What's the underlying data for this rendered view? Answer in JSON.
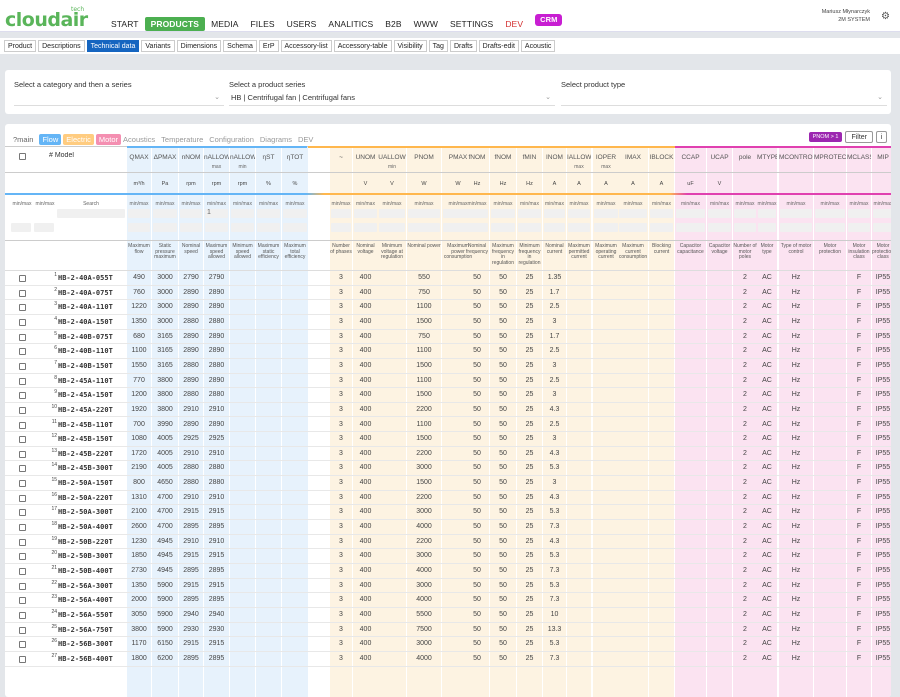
{
  "app": {
    "logo": "cloudair",
    "logo_sup": "tech",
    "nav": [
      "START",
      "PRODUCTS",
      "MEDIA",
      "FILES",
      "USERS",
      "ANALITICS",
      "B2B",
      "WWW",
      "SETTINGS",
      "DEV",
      "CRM"
    ],
    "active_nav": "PRODUCTS",
    "user_name": "Mariusz Młynarczyk",
    "user_company": "2M SYSTEM"
  },
  "subtabs": [
    "Product",
    "Descriptions",
    "Technical data",
    "Variants",
    "Dimensions",
    "Schema",
    "ErP",
    "Accessory-list",
    "Accessory-table",
    "Visibility",
    "Tag",
    "Drafts",
    "Drafts-edit",
    "Acoustic"
  ],
  "active_subtab": "Technical data",
  "filters": {
    "category_label": "Select a category and then a series",
    "category_value": "",
    "series_label": "Select a product series",
    "series_value": "HB | Centrifugal fan | Centrifugal fans",
    "type_label": "Select product type",
    "type_value": ""
  },
  "table_tabs": [
    "?main",
    "Flow",
    "Electric",
    "Motor",
    "Acoustics",
    "Temperature",
    "Configuration",
    "Diagrams",
    "DEV"
  ],
  "buttons": {
    "pnom": "PNOM > 1",
    "filter": "Filter",
    "info": "i"
  },
  "columns": {
    "model_header": "# Model",
    "search_label": "Search",
    "minmax": "min/max",
    "first_value": "1",
    "heads": [
      "QMAX",
      "ΔPMAX",
      "nNOM",
      "nALLOW",
      "nALLOW",
      "ηST",
      "ηTOT",
      "~",
      "UNOM",
      "UALLOW",
      "PNOM",
      "PMAX",
      "fNOM",
      "fNOM",
      "fMIN",
      "INOM",
      "IALLOW",
      "IOPER",
      "IMAX",
      "IBLOCK",
      "CCAP",
      "UCAP",
      "pole",
      "MTYPE",
      "MCONTROL",
      "MPROTECT",
      "MCLASS",
      "MIP"
    ],
    "subheads": [
      "",
      "",
      "",
      "max",
      "min",
      "",
      "",
      "",
      "",
      "min",
      "",
      "",
      "",
      "",
      "",
      "",
      "max",
      "max",
      "",
      "",
      "",
      "",
      "",
      "",
      "",
      "",
      "",
      ""
    ],
    "units": [
      "m³/h",
      "Pa",
      "rpm",
      "rpm",
      "rpm",
      "%",
      "%",
      "",
      "V",
      "V",
      "W",
      "W",
      "Hz",
      "Hz",
      "Hz",
      "A",
      "A",
      "A",
      "A",
      "A",
      "uF",
      "V",
      "",
      "",
      "",
      "",
      "",
      ""
    ],
    "descriptions": [
      "Maximum flow",
      "Static pressure maximum",
      "Nominal speed",
      "Maximum speed allowed",
      "Minimum speed allowed",
      "Maximum static efficiency",
      "Maximum total efficiency",
      "Number of phases",
      "Nominal voltage",
      "Minimum voltage at regulation",
      "Nominal power",
      "Maximum power consumption",
      "Nominal frequency",
      "Maximum frequency in regulation",
      "Minimum frequency in regulation",
      "Nominal current",
      "Maximum permitted current",
      "Maximum operating current",
      "Maximum current consumption",
      "Blocking current",
      "Capacitor capacitance",
      "Capacitor voltage",
      "Number of motor poles",
      "Motor type",
      "Type of motor control",
      "Motor protection",
      "Motor insulation class",
      "Motor protection class"
    ]
  },
  "rows": [
    {
      "n": "1",
      "model": "HB-2-40A-055T",
      "q": "490",
      "p": "3000",
      "n1": "2790",
      "n2": "2790",
      "ph": "3",
      "u": "400",
      "pw": "550",
      "f": "50",
      "f2": "50",
      "f3": "25",
      "i": "1.35",
      "pole": "2",
      "mt": "AC",
      "mc": "Hz",
      "cl": "F",
      "ip": "IP55"
    },
    {
      "n": "2",
      "model": "HB-2-40A-075T",
      "q": "760",
      "p": "3000",
      "n1": "2890",
      "n2": "2890",
      "ph": "3",
      "u": "400",
      "pw": "750",
      "f": "50",
      "f2": "50",
      "f3": "25",
      "i": "1.7",
      "pole": "2",
      "mt": "AC",
      "mc": "Hz",
      "cl": "F",
      "ip": "IP55"
    },
    {
      "n": "3",
      "model": "HB-2-40A-110T",
      "q": "1220",
      "p": "3000",
      "n1": "2890",
      "n2": "2890",
      "ph": "3",
      "u": "400",
      "pw": "1100",
      "f": "50",
      "f2": "50",
      "f3": "25",
      "i": "2.5",
      "pole": "2",
      "mt": "AC",
      "mc": "Hz",
      "cl": "F",
      "ip": "IP55"
    },
    {
      "n": "4",
      "model": "HB-2-40A-150T",
      "q": "1350",
      "p": "3000",
      "n1": "2880",
      "n2": "2880",
      "ph": "3",
      "u": "400",
      "pw": "1500",
      "f": "50",
      "f2": "50",
      "f3": "25",
      "i": "3",
      "pole": "2",
      "mt": "AC",
      "mc": "Hz",
      "cl": "F",
      "ip": "IP55"
    },
    {
      "n": "5",
      "model": "HB-2-40B-075T",
      "q": "680",
      "p": "3165",
      "n1": "2890",
      "n2": "2890",
      "ph": "3",
      "u": "400",
      "pw": "750",
      "f": "50",
      "f2": "50",
      "f3": "25",
      "i": "1.7",
      "pole": "2",
      "mt": "AC",
      "mc": "Hz",
      "cl": "F",
      "ip": "IP55"
    },
    {
      "n": "6",
      "model": "HB-2-40B-110T",
      "q": "1100",
      "p": "3165",
      "n1": "2890",
      "n2": "2890",
      "ph": "3",
      "u": "400",
      "pw": "1100",
      "f": "50",
      "f2": "50",
      "f3": "25",
      "i": "2.5",
      "pole": "2",
      "mt": "AC",
      "mc": "Hz",
      "cl": "F",
      "ip": "IP55"
    },
    {
      "n": "7",
      "model": "HB-2-40B-150T",
      "q": "1550",
      "p": "3165",
      "n1": "2880",
      "n2": "2880",
      "ph": "3",
      "u": "400",
      "pw": "1500",
      "f": "50",
      "f2": "50",
      "f3": "25",
      "i": "3",
      "pole": "2",
      "mt": "AC",
      "mc": "Hz",
      "cl": "F",
      "ip": "IP55"
    },
    {
      "n": "8",
      "model": "HB-2-45A-110T",
      "q": "770",
      "p": "3800",
      "n1": "2890",
      "n2": "2890",
      "ph": "3",
      "u": "400",
      "pw": "1100",
      "f": "50",
      "f2": "50",
      "f3": "25",
      "i": "2.5",
      "pole": "2",
      "mt": "AC",
      "mc": "Hz",
      "cl": "F",
      "ip": "IP55"
    },
    {
      "n": "9",
      "model": "HB-2-45A-150T",
      "q": "1200",
      "p": "3800",
      "n1": "2880",
      "n2": "2880",
      "ph": "3",
      "u": "400",
      "pw": "1500",
      "f": "50",
      "f2": "50",
      "f3": "25",
      "i": "3",
      "pole": "2",
      "mt": "AC",
      "mc": "Hz",
      "cl": "F",
      "ip": "IP55"
    },
    {
      "n": "10",
      "model": "HB-2-45A-220T",
      "q": "1920",
      "p": "3800",
      "n1": "2910",
      "n2": "2910",
      "ph": "3",
      "u": "400",
      "pw": "2200",
      "f": "50",
      "f2": "50",
      "f3": "25",
      "i": "4.3",
      "pole": "2",
      "mt": "AC",
      "mc": "Hz",
      "cl": "F",
      "ip": "IP55"
    },
    {
      "n": "11",
      "model": "HB-2-45B-110T",
      "q": "700",
      "p": "3990",
      "n1": "2890",
      "n2": "2890",
      "ph": "3",
      "u": "400",
      "pw": "1100",
      "f": "50",
      "f2": "50",
      "f3": "25",
      "i": "2.5",
      "pole": "2",
      "mt": "AC",
      "mc": "Hz",
      "cl": "F",
      "ip": "IP55"
    },
    {
      "n": "12",
      "model": "HB-2-45B-150T",
      "q": "1080",
      "p": "4005",
      "n1": "2925",
      "n2": "2925",
      "ph": "3",
      "u": "400",
      "pw": "1500",
      "f": "50",
      "f2": "50",
      "f3": "25",
      "i": "3",
      "pole": "2",
      "mt": "AC",
      "mc": "Hz",
      "cl": "F",
      "ip": "IP55"
    },
    {
      "n": "13",
      "model": "HB-2-45B-220T",
      "q": "1720",
      "p": "4005",
      "n1": "2910",
      "n2": "2910",
      "ph": "3",
      "u": "400",
      "pw": "2200",
      "f": "50",
      "f2": "50",
      "f3": "25",
      "i": "4.3",
      "pole": "2",
      "mt": "AC",
      "mc": "Hz",
      "cl": "F",
      "ip": "IP55"
    },
    {
      "n": "14",
      "model": "HB-2-45B-300T",
      "q": "2190",
      "p": "4005",
      "n1": "2880",
      "n2": "2880",
      "ph": "3",
      "u": "400",
      "pw": "3000",
      "f": "50",
      "f2": "50",
      "f3": "25",
      "i": "5.3",
      "pole": "2",
      "mt": "AC",
      "mc": "Hz",
      "cl": "F",
      "ip": "IP55"
    },
    {
      "n": "15",
      "model": "HB-2-50A-150T",
      "q": "800",
      "p": "4650",
      "n1": "2880",
      "n2": "2880",
      "ph": "3",
      "u": "400",
      "pw": "1500",
      "f": "50",
      "f2": "50",
      "f3": "25",
      "i": "3",
      "pole": "2",
      "mt": "AC",
      "mc": "Hz",
      "cl": "F",
      "ip": "IP55"
    },
    {
      "n": "16",
      "model": "HB-2-50A-220T",
      "q": "1310",
      "p": "4700",
      "n1": "2910",
      "n2": "2910",
      "ph": "3",
      "u": "400",
      "pw": "2200",
      "f": "50",
      "f2": "50",
      "f3": "25",
      "i": "4.3",
      "pole": "2",
      "mt": "AC",
      "mc": "Hz",
      "cl": "F",
      "ip": "IP55"
    },
    {
      "n": "17",
      "model": "HB-2-50A-300T",
      "q": "2100",
      "p": "4700",
      "n1": "2915",
      "n2": "2915",
      "ph": "3",
      "u": "400",
      "pw": "3000",
      "f": "50",
      "f2": "50",
      "f3": "25",
      "i": "5.3",
      "pole": "2",
      "mt": "AC",
      "mc": "Hz",
      "cl": "F",
      "ip": "IP55"
    },
    {
      "n": "18",
      "model": "HB-2-50A-400T",
      "q": "2600",
      "p": "4700",
      "n1": "2895",
      "n2": "2895",
      "ph": "3",
      "u": "400",
      "pw": "4000",
      "f": "50",
      "f2": "50",
      "f3": "25",
      "i": "7.3",
      "pole": "2",
      "mt": "AC",
      "mc": "Hz",
      "cl": "F",
      "ip": "IP55"
    },
    {
      "n": "19",
      "model": "HB-2-50B-220T",
      "q": "1230",
      "p": "4945",
      "n1": "2910",
      "n2": "2910",
      "ph": "3",
      "u": "400",
      "pw": "2200",
      "f": "50",
      "f2": "50",
      "f3": "25",
      "i": "4.3",
      "pole": "2",
      "mt": "AC",
      "mc": "Hz",
      "cl": "F",
      "ip": "IP55"
    },
    {
      "n": "20",
      "model": "HB-2-50B-300T",
      "q": "1850",
      "p": "4945",
      "n1": "2915",
      "n2": "2915",
      "ph": "3",
      "u": "400",
      "pw": "3000",
      "f": "50",
      "f2": "50",
      "f3": "25",
      "i": "5.3",
      "pole": "2",
      "mt": "AC",
      "mc": "Hz",
      "cl": "F",
      "ip": "IP55"
    },
    {
      "n": "21",
      "model": "HB-2-50B-400T",
      "q": "2730",
      "p": "4945",
      "n1": "2895",
      "n2": "2895",
      "ph": "3",
      "u": "400",
      "pw": "4000",
      "f": "50",
      "f2": "50",
      "f3": "25",
      "i": "7.3",
      "pole": "2",
      "mt": "AC",
      "mc": "Hz",
      "cl": "F",
      "ip": "IP55"
    },
    {
      "n": "22",
      "model": "HB-2-56A-300T",
      "q": "1350",
      "p": "5900",
      "n1": "2915",
      "n2": "2915",
      "ph": "3",
      "u": "400",
      "pw": "3000",
      "f": "50",
      "f2": "50",
      "f3": "25",
      "i": "5.3",
      "pole": "2",
      "mt": "AC",
      "mc": "Hz",
      "cl": "F",
      "ip": "IP55"
    },
    {
      "n": "23",
      "model": "HB-2-56A-400T",
      "q": "2000",
      "p": "5900",
      "n1": "2895",
      "n2": "2895",
      "ph": "3",
      "u": "400",
      "pw": "4000",
      "f": "50",
      "f2": "50",
      "f3": "25",
      "i": "7.3",
      "pole": "2",
      "mt": "AC",
      "mc": "Hz",
      "cl": "F",
      "ip": "IP55"
    },
    {
      "n": "24",
      "model": "HB-2-56A-550T",
      "q": "3050",
      "p": "5900",
      "n1": "2940",
      "n2": "2940",
      "ph": "3",
      "u": "400",
      "pw": "5500",
      "f": "50",
      "f2": "50",
      "f3": "25",
      "i": "10",
      "pole": "2",
      "mt": "AC",
      "mc": "Hz",
      "cl": "F",
      "ip": "IP55"
    },
    {
      "n": "25",
      "model": "HB-2-56A-750T",
      "q": "3800",
      "p": "5900",
      "n1": "2930",
      "n2": "2930",
      "ph": "3",
      "u": "400",
      "pw": "7500",
      "f": "50",
      "f2": "50",
      "f3": "25",
      "i": "13.3",
      "pole": "2",
      "mt": "AC",
      "mc": "Hz",
      "cl": "F",
      "ip": "IP55"
    },
    {
      "n": "26",
      "model": "HB-2-56B-300T",
      "q": "1170",
      "p": "6150",
      "n1": "2915",
      "n2": "2915",
      "ph": "3",
      "u": "400",
      "pw": "3000",
      "f": "50",
      "f2": "50",
      "f3": "25",
      "i": "5.3",
      "pole": "2",
      "mt": "AC",
      "mc": "Hz",
      "cl": "F",
      "ip": "IP55"
    },
    {
      "n": "27",
      "model": "HB-2-56B-400T",
      "q": "1800",
      "p": "6200",
      "n1": "2895",
      "n2": "2895",
      "ph": "3",
      "u": "400",
      "pw": "4000",
      "f": "50",
      "f2": "50",
      "f3": "25",
      "i": "7.3",
      "pole": "2",
      "mt": "AC",
      "mc": "Hz",
      "cl": "F",
      "ip": "IP55"
    }
  ]
}
